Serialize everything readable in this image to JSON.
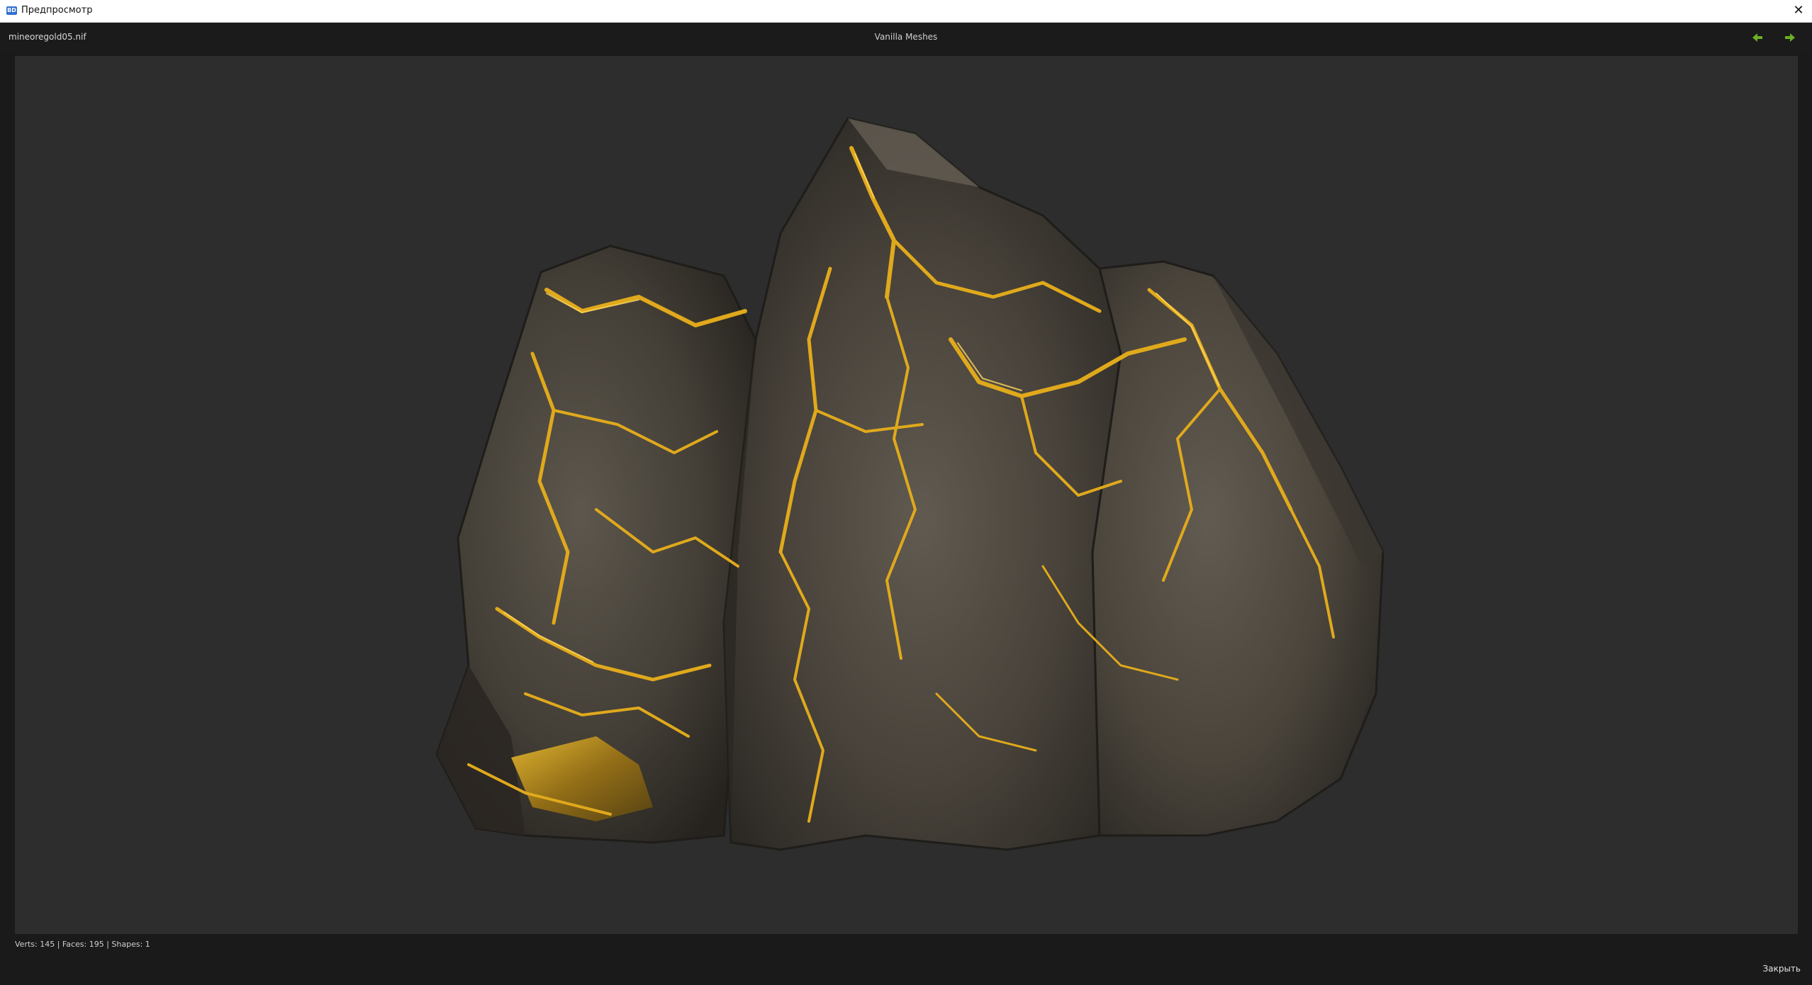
{
  "window": {
    "title": "Предпросмотр",
    "close_icon": "close-icon",
    "app_icon_text": "BD"
  },
  "header": {
    "filename": "mineoregold05.nif",
    "collection": "Vanilla Meshes",
    "prev_icon": "arrow-left-icon",
    "next_icon": "arrow-right-icon",
    "nav_color": "#6ab026"
  },
  "viewport": {
    "background": "#2d2d2d",
    "model": "gold-ore-rock-3d-model"
  },
  "footer": {
    "stats": "Verts: 145 | Faces: 195 | Shapes: 1",
    "close_label": "Закрыть"
  },
  "colors": {
    "rock_dark": "#3a3630",
    "rock_mid": "#5a544a",
    "gold": "#d4a017",
    "gold_bright": "#f2c230"
  }
}
